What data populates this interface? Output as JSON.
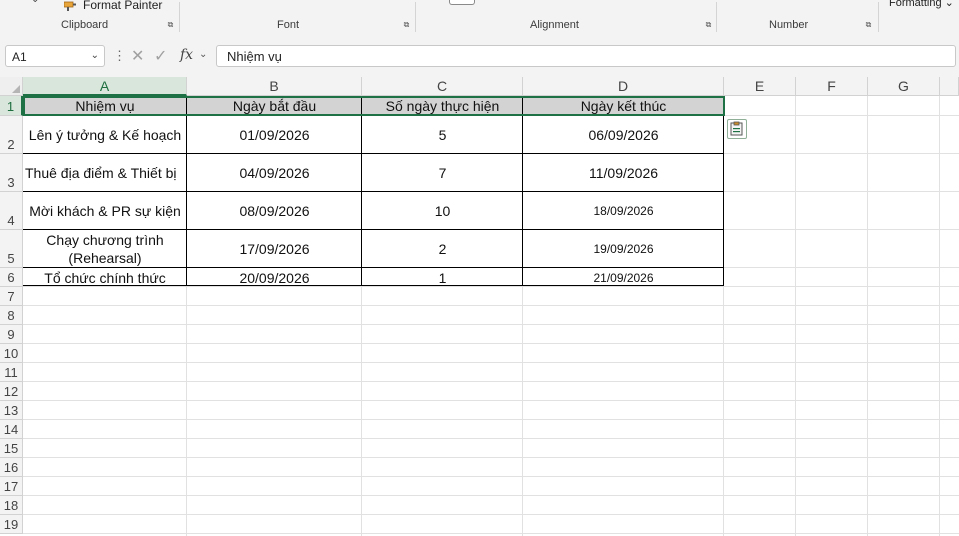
{
  "ribbon": {
    "format_painter": "Format Painter",
    "formatting": "Formatting",
    "groups": [
      {
        "label": "Clipboard"
      },
      {
        "label": "Font"
      },
      {
        "label": "Alignment"
      },
      {
        "label": "Number"
      }
    ]
  },
  "formula_bar": {
    "name_box": "A1",
    "fx": "fx",
    "content": "Nhiệm vụ"
  },
  "columns": [
    "A",
    "B",
    "C",
    "D",
    "E",
    "F",
    "G"
  ],
  "rows": [
    "1",
    "2",
    "3",
    "4",
    "5",
    "6",
    "7",
    "8",
    "9",
    "10",
    "11",
    "12",
    "13",
    "14",
    "15",
    "16",
    "17",
    "18",
    "19"
  ],
  "table": {
    "headers": [
      "Nhiệm vụ",
      "Ngày bắt đầu",
      "Số ngày thực hiện",
      "Ngày kết thúc"
    ],
    "rows": [
      [
        "Lên ý tưởng & Kế hoạch",
        "01/09/2026",
        "5",
        "06/09/2026"
      ],
      [
        "Thuê địa điểm & Thiết bị",
        "04/09/2026",
        "7",
        "11/09/2026"
      ],
      [
        "Mời khách & PR sự kiện",
        "08/09/2026",
        "10",
        "18/09/2026"
      ],
      [
        "Chạy chương trình (Rehearsal)",
        "17/09/2026",
        "2",
        "19/09/2026"
      ],
      [
        "Tổ chức chính thức",
        "20/09/2026",
        "1",
        "21/09/2026"
      ]
    ]
  },
  "selection": {
    "active_cell": "A1"
  },
  "colors": {
    "accent": "#1e7145",
    "header_fill": "#d3d3d3"
  }
}
